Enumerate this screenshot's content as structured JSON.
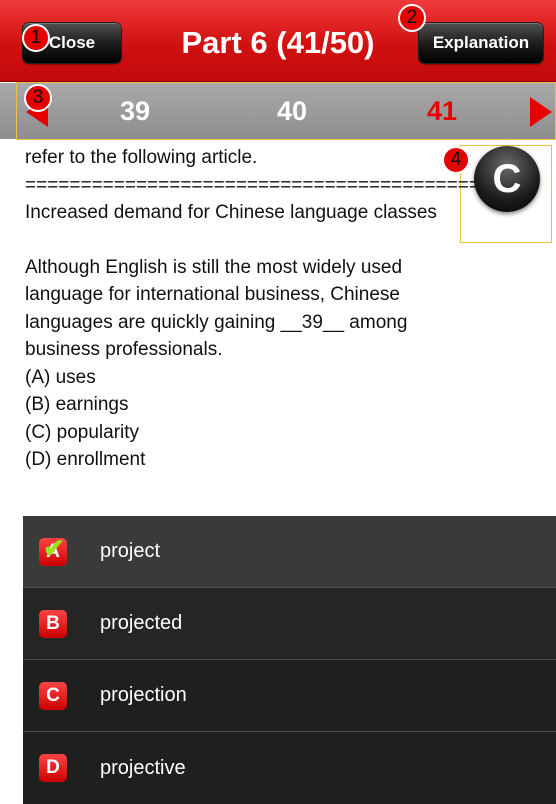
{
  "header": {
    "close_label": "Close",
    "title": "Part 6 (41/50)",
    "explanation_label": "Explanation"
  },
  "markers": [
    "1",
    "2",
    "3",
    "4"
  ],
  "nav": {
    "numbers": [
      "39",
      "40",
      "41"
    ],
    "current": "41"
  },
  "floating_button": {
    "label": "C"
  },
  "article": {
    "lines": [
      "refer to the following article.",
      "==========================================",
      "Increased demand for Chinese language classes",
      "Although English is still the most widely used",
      "language for international business, Chinese",
      "languages are quickly gaining __39__ among",
      "business professionals.",
      "(A) uses",
      "(B) earnings",
      "(C) popularity",
      "(D) enrollment"
    ]
  },
  "answers": [
    {
      "letter": "A",
      "label": "project",
      "selected": true
    },
    {
      "letter": "B",
      "label": "projected",
      "selected": false
    },
    {
      "letter": "C",
      "label": "projection",
      "selected": false
    },
    {
      "letter": "D",
      "label": "projective",
      "selected": false
    }
  ],
  "colors": {
    "accent": "#e60000",
    "header_bg": "#d21010",
    "nav_bg": "#999999",
    "answers_bg": "#222222",
    "check": "#9be31a"
  },
  "icons": {
    "prev": "triangle-left-icon",
    "next": "triangle-right-icon",
    "selected": "check-icon"
  }
}
